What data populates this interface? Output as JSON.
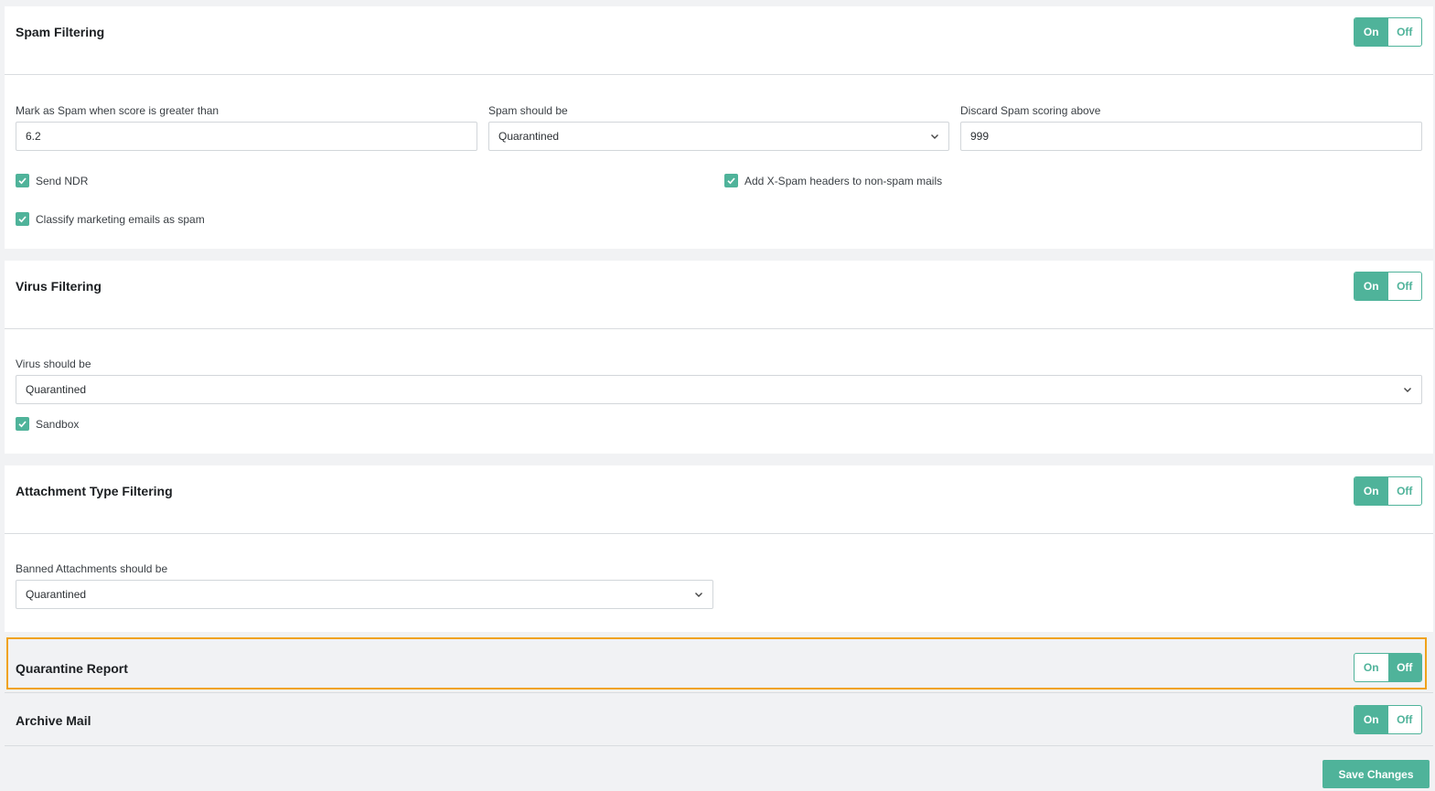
{
  "spam": {
    "title": "Spam Filtering",
    "toggle": {
      "on": "On",
      "off": "Off",
      "state": "on"
    },
    "score_label": "Mark as Spam when score is greater than",
    "score_value": "6.2",
    "action_label": "Spam should be",
    "action_value": "Quarantined",
    "discard_label": "Discard Spam scoring above",
    "discard_value": "999",
    "send_ndr": {
      "label": "Send NDR",
      "checked": true
    },
    "xspam": {
      "label": "Add X-Spam headers to non-spam mails",
      "checked": true
    },
    "marketing": {
      "label": "Classify marketing emails as spam",
      "checked": true
    }
  },
  "virus": {
    "title": "Virus Filtering",
    "toggle": {
      "on": "On",
      "off": "Off",
      "state": "on"
    },
    "action_label": "Virus should be",
    "action_value": "Quarantined",
    "sandbox": {
      "label": "Sandbox",
      "checked": true
    }
  },
  "attachment": {
    "title": "Attachment Type Filtering",
    "toggle": {
      "on": "On",
      "off": "Off",
      "state": "on"
    },
    "action_label": "Banned Attachments should be",
    "action_value": "Quarantined"
  },
  "quarantine_report": {
    "title": "Quarantine Report",
    "toggle": {
      "on": "On",
      "off": "Off",
      "state": "off"
    }
  },
  "archive": {
    "title": "Archive Mail",
    "toggle": {
      "on": "On",
      "off": "Off",
      "state": "on"
    }
  },
  "save_label": "Save Changes",
  "colors": {
    "accent": "#4fb39a",
    "highlight": "#f0a21a"
  }
}
